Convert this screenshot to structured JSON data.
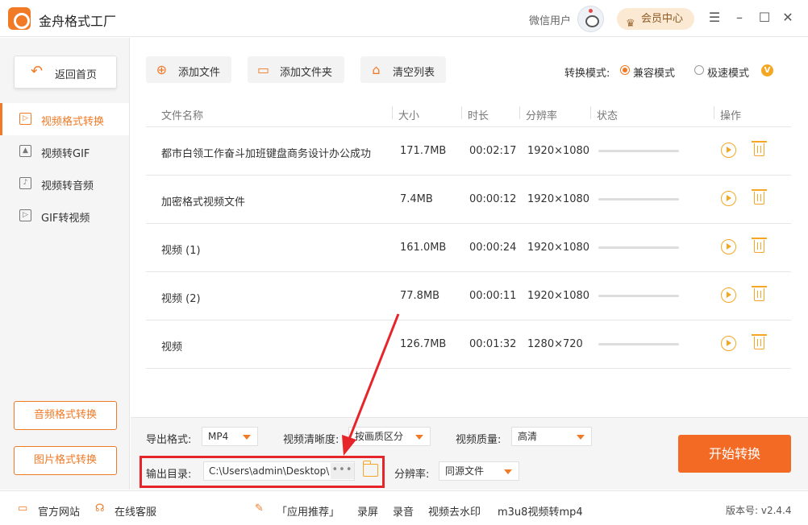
{
  "app": {
    "title": "金舟格式工厂"
  },
  "header": {
    "wechat_user": "微信用户",
    "vip_center": "会员中心"
  },
  "window_controls": {
    "menu": "☰",
    "minimize": "–",
    "maximize": "☐",
    "close": "✕"
  },
  "sidebar": {
    "home_button": "返回首页",
    "items": [
      {
        "label": "视频格式转换",
        "active": true,
        "icon": "video-icon"
      },
      {
        "label": "视频转GIF",
        "active": false,
        "icon": "image-icon"
      },
      {
        "label": "视频转音频",
        "active": false,
        "icon": "music-icon"
      },
      {
        "label": "GIF转视频",
        "active": false,
        "icon": "gif-icon"
      }
    ],
    "bottom_buttons": [
      "音频格式转换",
      "图片格式转换"
    ]
  },
  "toolbar": {
    "add_file": "添加文件",
    "add_folder": "添加文件夹",
    "clear_list": "清空列表",
    "mode_label": "转换模式:",
    "mode_compatible": "兼容模式",
    "mode_fast": "极速模式",
    "selected_mode": "兼容模式",
    "fast_mode_badge": "V"
  },
  "table": {
    "headers": [
      "文件名称",
      "大小",
      "时长",
      "分辨率",
      "状态",
      "操作"
    ],
    "rows": [
      {
        "name": "都市白领工作奋斗加班键盘商务设计办公成功",
        "size": "171.7MB",
        "duration": "00:02:17",
        "resolution": "1920×1080",
        "progress": 0
      },
      {
        "name": "加密格式视频文件",
        "size": "7.4MB",
        "duration": "00:00:12",
        "resolution": "1920×1080",
        "progress": 0
      },
      {
        "name": "视频 (1)",
        "size": "161.0MB",
        "duration": "00:00:24",
        "resolution": "1920×1080",
        "progress": 0
      },
      {
        "name": "视频 (2)",
        "size": "77.8MB",
        "duration": "00:00:11",
        "resolution": "1920×1080",
        "progress": 0
      },
      {
        "name": "视频",
        "size": "126.7MB",
        "duration": "00:01:32",
        "resolution": "1280×720",
        "progress": 0
      }
    ]
  },
  "bottom": {
    "export_format_label": "导出格式:",
    "export_format_value": "MP4",
    "clarity_label": "视频清晰度:",
    "clarity_value": "按画质区分",
    "quality_label": "视频质量:",
    "quality_value": "高清",
    "output_dir_label": "输出目录:",
    "output_dir_value": "C:\\Users\\admin\\Desktop\\",
    "more_button": "•••",
    "resolution_label": "分辨率:",
    "resolution_value": "同源文件",
    "start_button": "开始转换"
  },
  "statusbar": {
    "official_site": "官方网站",
    "online_service": "在线客服",
    "app_recommend": "「应用推荐」",
    "links": [
      "录屏",
      "录音",
      "视频去水印",
      "m3u8视频转mp4"
    ],
    "version": "版本号: v2.4.4"
  },
  "colors": {
    "accent": "#f07a26",
    "highlight": "#e5252a",
    "start_button": "#f36a25"
  }
}
